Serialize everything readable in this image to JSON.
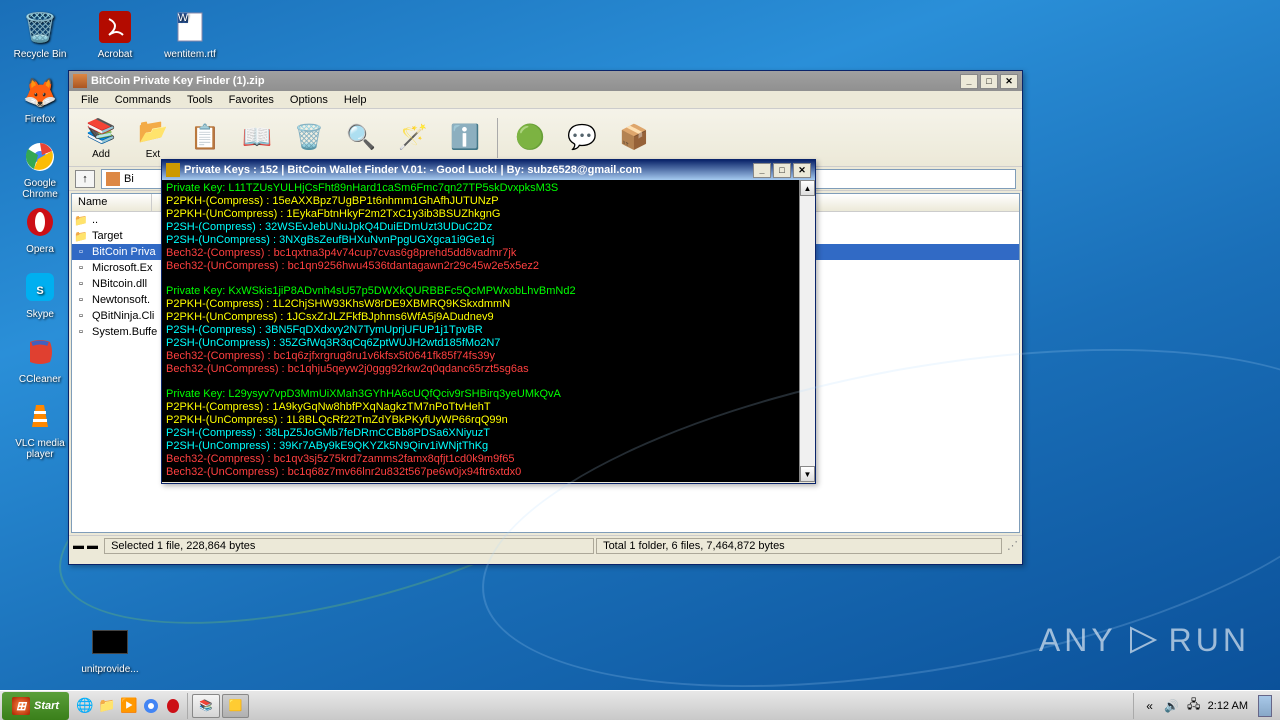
{
  "desktop_icons": {
    "recycle": "Recycle Bin",
    "acrobat": "Acrobat",
    "wentitem": "wentitem.rtf",
    "firefox": "Firefox",
    "chrome": "Google Chrome",
    "opera": "Opera",
    "skype": "Skype",
    "ccleaner": "CCleaner",
    "vlc": "VLC media player",
    "unitprovide": "unitprovide..."
  },
  "archive_window": {
    "title": "BitCoin Private Key Finder (1).zip",
    "menu": [
      "File",
      "Commands",
      "Tools",
      "Favorites",
      "Options",
      "Help"
    ],
    "toolbar": {
      "add": "Add",
      "ext": "Ext"
    },
    "address_prefix": "Bi",
    "columns": {
      "name": "Name"
    },
    "files": [
      {
        "name": "..",
        "type": "up"
      },
      {
        "name": "Target",
        "type": "folder"
      },
      {
        "name": "BitCoin Priva",
        "type": "file",
        "selected": true
      },
      {
        "name": "Microsoft.Ex",
        "type": "file"
      },
      {
        "name": "NBitcoin.dll",
        "type": "file"
      },
      {
        "name": "Newtonsoft.",
        "type": "file"
      },
      {
        "name": "QBitNinja.Cli",
        "type": "file"
      },
      {
        "name": "System.Buffe",
        "type": "file"
      }
    ],
    "status_left": "Selected 1 file, 228,864 bytes",
    "status_right": "Total 1 folder, 6 files, 7,464,872 bytes"
  },
  "console_window": {
    "title": "Private Keys : 152 |  BitCoin Wallet Finder V.01: - Good Luck! | By: subz6528@gmail.com",
    "blocks": [
      {
        "pk": "Private Key: L11TZUsYULHjCsFht89nHard1caSm6Fmc7qn27TP5skDvxpksM3S",
        "p2pkh_c": "P2PKH-(Compress) : 15eAXXBpz7UgBP1t6nhmm1GhAfhJUTUNzP",
        "p2pkh_u": "P2PKH-(UnCompress) : 1EykaFbtnHkyF2m2TxC1y3ib3BSUZhkgnG",
        "p2sh_c": "P2SH-(Compress) : 32WSEvJebUNuJpkQ4DuiEDmUzt3UDuC2Dz",
        "p2sh_u": "P2SH-(UnCompress) : 3NXgBsZeufBHXuNvnPpgUGXgca1i9Ge1cj",
        "b32_c": "Bech32-(Compress) : bc1qxtna3p4v74cup7cvas6g8prehd5dd8vadmr7jk",
        "b32_u": "Bech32-(UnCompress) : bc1qn9256hwu4536tdantagawn2r29c45w2e5x5ez2"
      },
      {
        "pk": "Private Key: KxWSkis1jiP8ADvnh4sU57p5DWXkQURBBFc5QcMPWxobLhvBmNd2",
        "p2pkh_c": "P2PKH-(Compress) : 1L2ChjSHW93KhsW8rDE9XBMRQ9KSkxdmmN",
        "p2pkh_u": "P2PKH-(UnCompress) : 1JCsxZrJLZFkfBJphms6WfA5j9ADudnev9",
        "p2sh_c": "P2SH-(Compress) : 3BN5FqDXdxvy2N7TymUprjUFUP1j1TpvBR",
        "p2sh_u": "P2SH-(UnCompress) : 35ZGfWq3R3qCq6ZptWUJH2wtd185fMo2N7",
        "b32_c": "Bech32-(Compress) : bc1q6zjfxrgrug8ru1v6kfsx5t0641fk85f74fs39y",
        "b32_u": "Bech32-(UnCompress) : bc1qhju5qeyw2j0ggg92rkw2q0qdanc65rzt5sg6as"
      },
      {
        "pk": "Private Key: L29ysyv7vpD3MmUiXMah3GYhHA6cUQfQciv9rSHBirq3yeUMkQvA",
        "p2pkh_c": "P2PKH-(Compress) : 1A9kyGqNw8hbfPXqNagkzTM7nPoTtvHehT",
        "p2pkh_u": "P2PKH-(UnCompress) : 1L8BLQcRf22TmZdYBkPKyfUyWP66rqQ99n",
        "p2sh_c": "P2SH-(Compress) : 38LpZ5JoGMb7feDRmCCBb8PDSa6XNiyuzT",
        "p2sh_u": "P2SH-(UnCompress) : 39Kr7ABy9kE9QKYZk5N9Qirv1iWNjtThKg",
        "b32_c": "Bech32-(Compress) : bc1qv3sj5z75krd7zamms2famx8qfjt1cd0k9m9f65",
        "b32_u": "Bech32-(UnCompress) : bc1q68z7mv66lnr2u832t567pe6w0jx94ftr6xtdx0"
      }
    ]
  },
  "taskbar": {
    "start": "Start",
    "clock": "2:12 AM"
  },
  "watermark": "ANY     RUN"
}
